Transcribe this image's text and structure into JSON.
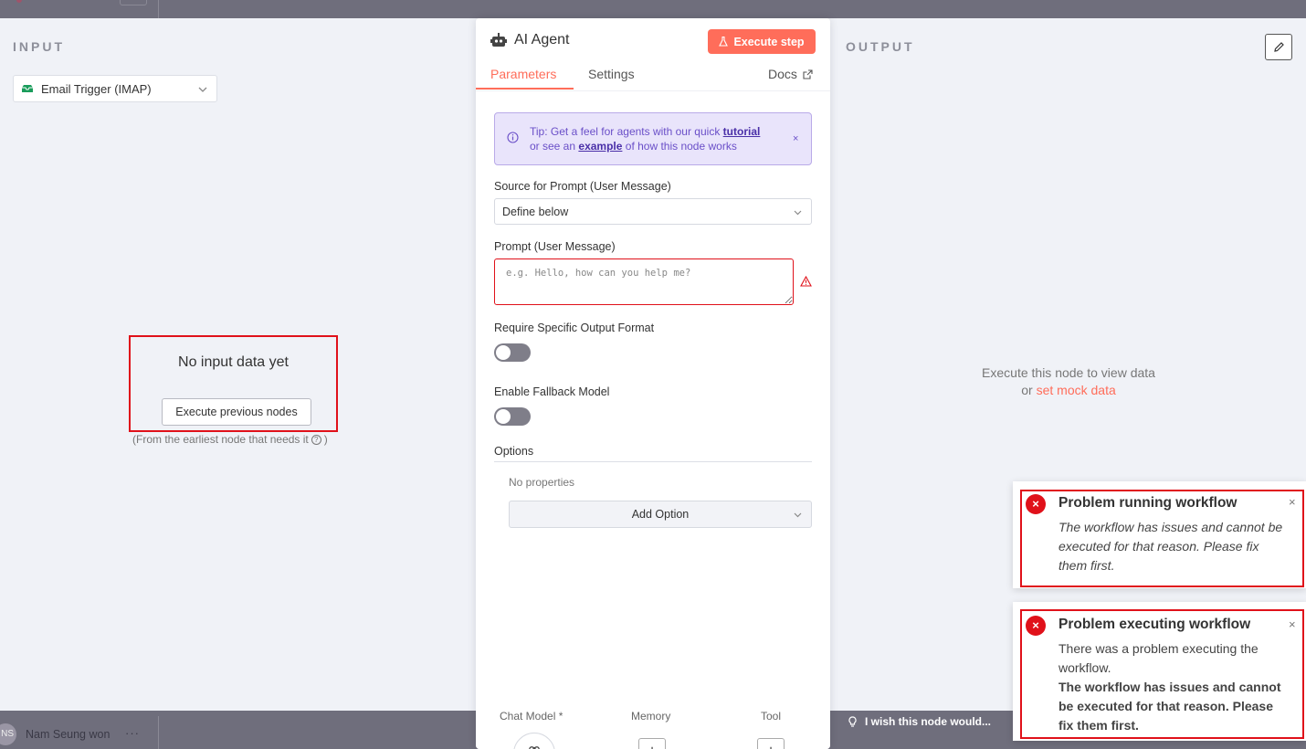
{
  "input_panel": {
    "title": "INPUT",
    "trigger_select": "Email Trigger (IMAP)",
    "empty_title": "No input data yet",
    "execute_previous_button": "Execute previous nodes",
    "earliest_note_prefix": "(From the earliest node that needs it",
    "earliest_note_suffix": ")"
  },
  "output_panel": {
    "title": "OUTPUT",
    "empty_line1": "Execute this node to view data",
    "empty_or": "or",
    "mock_link": "set mock data"
  },
  "node_panel": {
    "name": "AI Agent",
    "execute_step_button": "Execute step",
    "tabs": [
      "Parameters",
      "Settings"
    ],
    "docs_label": "Docs",
    "tip": {
      "part1": "Tip: Get a feel for agents with our quick",
      "link1": "tutorial",
      "part2": "or see an",
      "link2": "example",
      "part3": "of how this node works",
      "close": "×"
    },
    "source_label": "Source for Prompt (User Message)",
    "source_value": "Define below",
    "prompt_label": "Prompt (User Message)",
    "prompt_placeholder": "e.g. Hello, how can you help me?",
    "require_format_label": "Require Specific Output Format",
    "fallback_label": "Enable Fallback Model",
    "options_label": "Options",
    "no_properties": "No properties",
    "add_option_button": "Add Option",
    "sub_nodes": {
      "chat_model": "Chat Model *",
      "memory": "Memory",
      "tool": "Tool",
      "plus": "+"
    }
  },
  "toasts": [
    {
      "title": "Problem running workflow",
      "body": "The workflow has issues and cannot be executed for that reason. Please fix them first.",
      "close": "×",
      "icon": "×"
    },
    {
      "title": "Problem executing workflow",
      "body": "There was a problem executing the workflow.",
      "body_bold": "The workflow has issues and cannot be executed for that reason. Please fix them first.",
      "close": "×",
      "icon": "×"
    }
  ],
  "background": {
    "user_name": "Nam Seung won",
    "user_initials": "NS",
    "user_menu": "···",
    "wish_text": "I wish this node would..."
  },
  "colors": {
    "accent": "#ff6d5a",
    "error": "#e0111a",
    "tip_bg": "#e9e4fb",
    "tip_text": "#6a4fc8"
  }
}
